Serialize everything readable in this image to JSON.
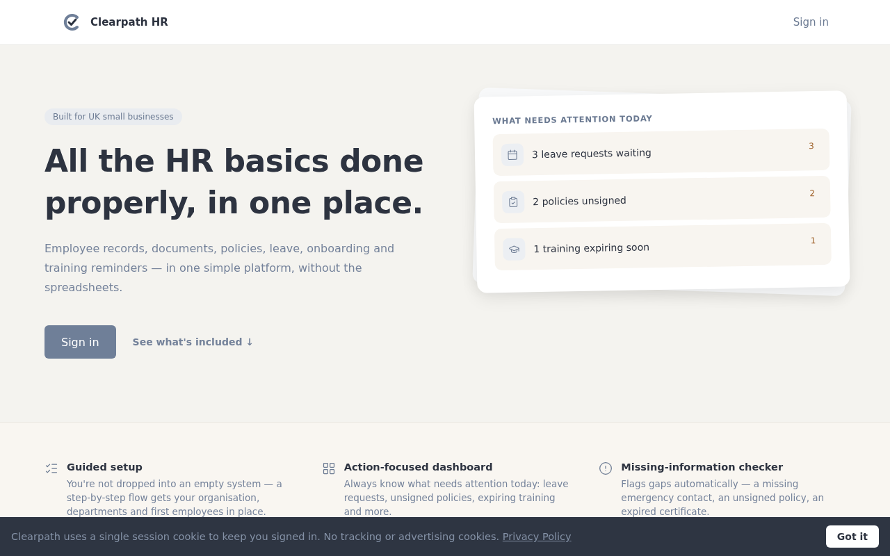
{
  "header": {
    "brand": "Clearpath HR",
    "sign_in": "Sign in"
  },
  "hero": {
    "badge": "Built for UK small businesses",
    "title_lines": [
      "All the HR basics done",
      "properly, in one place."
    ],
    "subtitle": "Employee records, documents, policies, leave, onboarding and training reminders — in one simple platform, without the spreadsheets.",
    "primary_button": "Sign in",
    "secondary_link": "See what's included ↓"
  },
  "attention_card": {
    "title": "WHAT NEEDS ATTENTION TODAY",
    "items": [
      {
        "label": "3 leave requests waiting",
        "count": "3"
      },
      {
        "label": "2 policies unsigned",
        "count": "2"
      },
      {
        "label": "1 training expiring soon",
        "count": "1"
      }
    ]
  },
  "features": [
    {
      "title": "Guided setup",
      "text": "You're not dropped into an empty system — a step-by-step flow gets your organisation, departments and first employees in place."
    },
    {
      "title": "Action-focused dashboard",
      "text": "Always know what needs attention today: leave requests, unsigned policies, expiring training and more."
    },
    {
      "title": "Missing-information checker",
      "text": "Flags gaps automatically — a missing emergency contact, an unsigned policy, an expired certificate."
    }
  ],
  "cookie_bar": {
    "text": "Clearpath uses a single session cookie to keep you signed in. No tracking or advertising cookies.",
    "link": "Privacy Policy",
    "button": "Got it"
  }
}
